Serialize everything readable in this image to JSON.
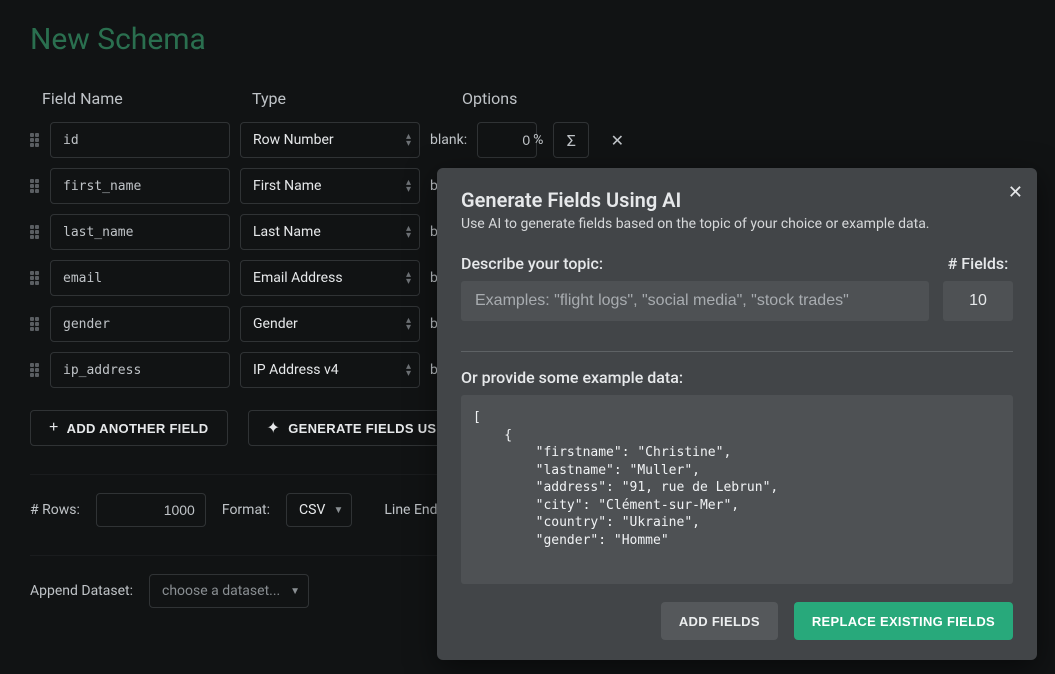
{
  "title": "New Schema",
  "columns": {
    "field": "Field Name",
    "type": "Type",
    "options": "Options"
  },
  "option_labels": {
    "blank": "blank:",
    "pct": "%"
  },
  "rows": [
    {
      "name": "id",
      "type": "Row Number",
      "blank": "0"
    },
    {
      "name": "first_name",
      "type": "First Name",
      "blank": ""
    },
    {
      "name": "last_name",
      "type": "Last Name",
      "blank": ""
    },
    {
      "name": "email",
      "type": "Email Address",
      "blank": ""
    },
    {
      "name": "gender",
      "type": "Gender",
      "blank": ""
    },
    {
      "name": "ip_address",
      "type": "IP Address v4",
      "blank": ""
    }
  ],
  "row0_blank_prefix": "b",
  "actions": {
    "add_field": "ADD ANOTHER FIELD",
    "gen_ai": "GENERATE FIELDS USING AI"
  },
  "bottom": {
    "rows_label": "# Rows:",
    "rows_value": "1000",
    "format_label": "Format:",
    "format_value": "CSV",
    "line_ending_label": "Line Ending:"
  },
  "append": {
    "label": "Append Dataset:",
    "placeholder": "choose a dataset..."
  },
  "modal": {
    "title": "Generate Fields Using AI",
    "subtitle": "Use AI to generate fields based on the topic of your choice or example data.",
    "topic_label": "Describe your topic:",
    "topic_placeholder": "Examples: \"flight logs\", \"social media\", \"stock trades\"",
    "fields_label": "# Fields:",
    "fields_value": "10",
    "example_label": "Or provide some example data:",
    "example_text": "[\n    {\n        \"firstname\": \"Christine\",\n        \"lastname\": \"Muller\",\n        \"address\": \"91, rue de Lebrun\",\n        \"city\": \"Clément-sur-Mer\",\n        \"country\": \"Ukraine\",\n        \"gender\": \"Homme\"",
    "add_btn": "ADD FIELDS",
    "replace_btn": "REPLACE EXISTING FIELDS"
  }
}
